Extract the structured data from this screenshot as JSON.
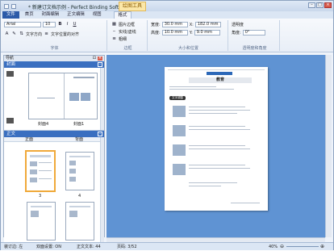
{
  "titlebar": {
    "title": "* 新建订文档示例 - Perfect Binding Software",
    "context_tab": "绘图工具"
  },
  "tabs": [
    "文件",
    "首页",
    "封面编辑",
    "正文编辑",
    "视图",
    "格式"
  ],
  "ribbon": {
    "font": {
      "font_name": "Arial",
      "font_size": "10",
      "bold": "B",
      "italic": "I",
      "underline": "U",
      "text_dir": "文字方向",
      "text_align": "文字位置的对齐",
      "label": "字体"
    },
    "border": {
      "fill_line": "图片边框",
      "border_line": "实线/虚线",
      "thickness": "粗细",
      "label": "边框"
    },
    "size": {
      "width_label": "宽度:",
      "width_value": "30.0 mm",
      "height_label": "高度:",
      "height_value": "10.0 mm",
      "x_label": "X:",
      "x_value": "182.0 mm",
      "y_label": "Y:",
      "y_value": "9.0 mm",
      "label": "大小和位置"
    },
    "transparency": {
      "opacity_label": "透明度",
      "angle_label": "角度:",
      "angle_value": "0°",
      "label": "透明度和角度"
    }
  },
  "left_pane": {
    "header": "导航",
    "cover_section": "封面",
    "cover_labels": [
      "封面4",
      "封面1"
    ],
    "body_section": "正文",
    "body_cols": [
      "正面",
      "背面"
    ],
    "body_page_nums": [
      "3",
      "4"
    ]
  },
  "document": {
    "heading": "教育",
    "section_badge": "文字调整"
  },
  "status": {
    "left": "装订边: 左",
    "mid1": "双面设置: ON",
    "mid2": "正文文本: 44",
    "mid3": "页码: 3/52",
    "zoom": "40%"
  },
  "colors": {
    "work_bg": "#5f93d3",
    "accent": "#2b5aa8"
  }
}
